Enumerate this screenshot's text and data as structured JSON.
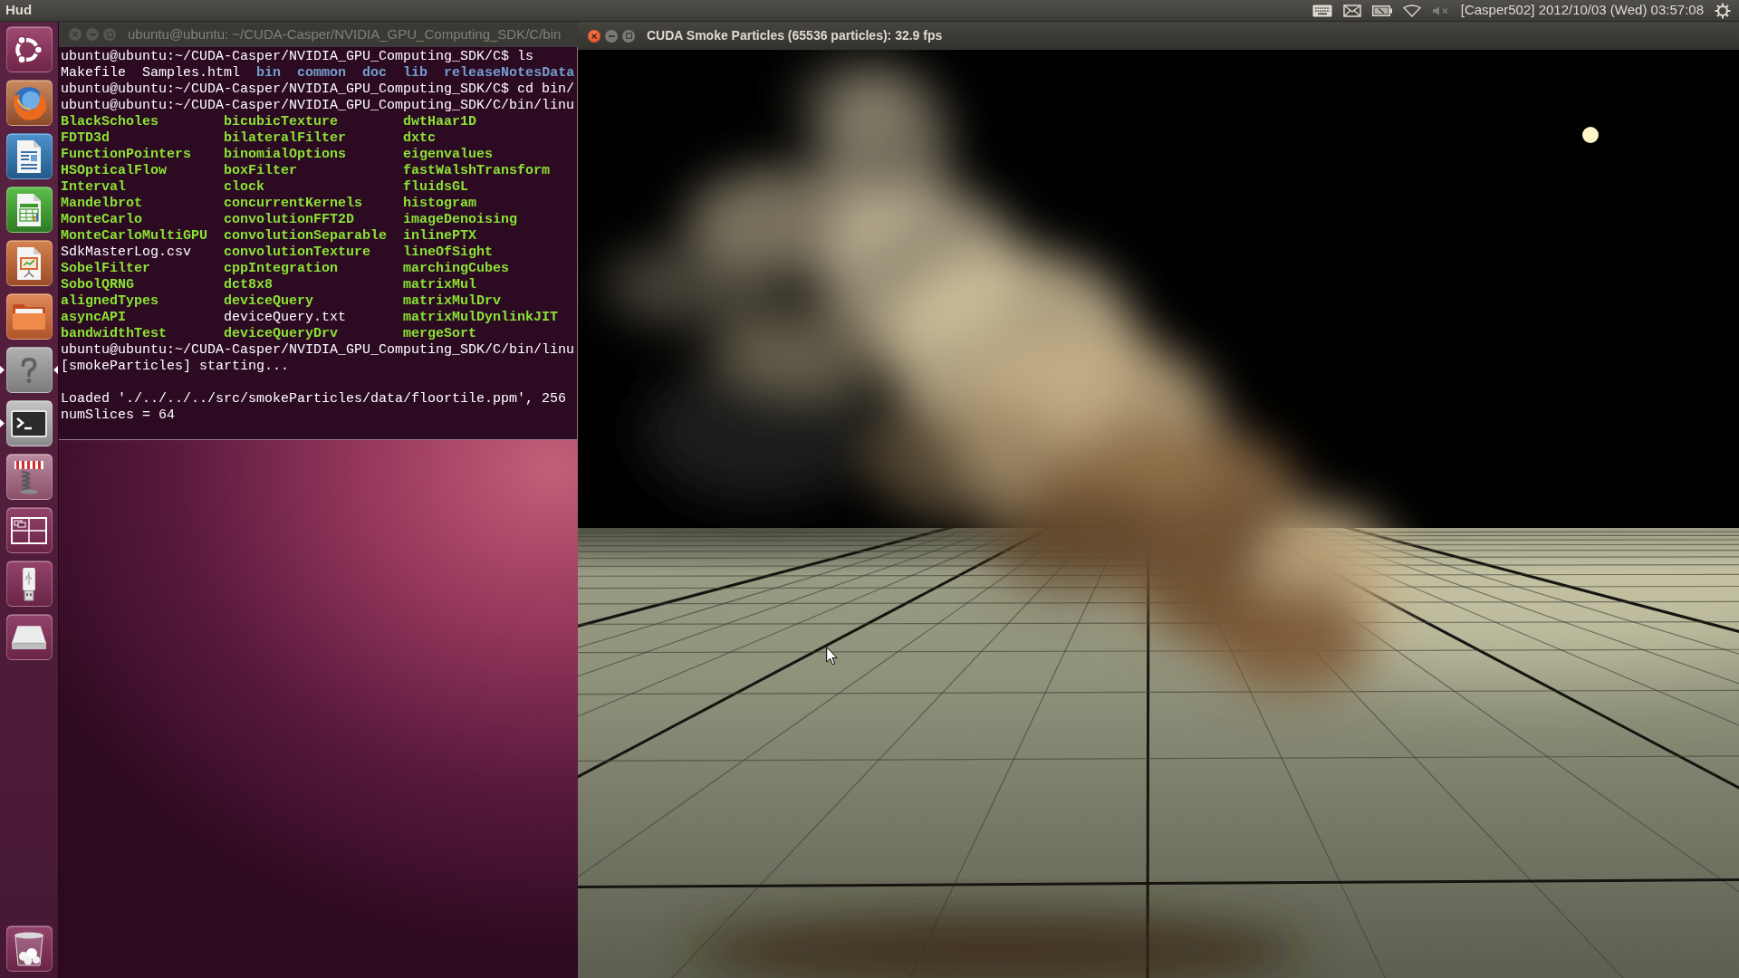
{
  "top_panel": {
    "title": "Hud",
    "sound_muted": true,
    "clock": "[Casper502] 2012/10/03 (Wed) 03:57:08"
  },
  "launcher": {
    "items": [
      {
        "kind": "dash",
        "running": false,
        "focused": false
      },
      {
        "kind": "browser",
        "running": false,
        "focused": false
      },
      {
        "kind": "writer",
        "running": false,
        "focused": false
      },
      {
        "kind": "calc",
        "running": false,
        "focused": false
      },
      {
        "kind": "impress",
        "running": false,
        "focused": false
      },
      {
        "kind": "files",
        "running": false,
        "focused": false
      },
      {
        "kind": "unknown",
        "running": true,
        "focused": true
      },
      {
        "kind": "terminal",
        "running": true,
        "focused": false
      },
      {
        "kind": "spring",
        "running": false,
        "focused": false
      },
      {
        "kind": "workspaces",
        "running": false,
        "focused": false
      },
      {
        "kind": "usb",
        "running": false,
        "focused": false
      },
      {
        "kind": "disk",
        "running": false,
        "focused": false
      },
      {
        "kind": "trash",
        "running": false,
        "focused": false
      }
    ]
  },
  "terminal_window": {
    "title": "ubuntu@ubuntu: ~/CUDA-Casper/NVIDIA_GPU_Computing_SDK/C/bin",
    "active": false,
    "lines": [
      {
        "kind": "text",
        "text": "ubuntu@ubuntu:~/CUDA-Casper/NVIDIA_GPU_Computing_SDK/C$ ls"
      },
      {
        "kind": "files",
        "items": [
          {
            "name": "Makefile",
            "kind": "file"
          },
          {
            "name": "Samples.html",
            "kind": "file"
          },
          {
            "name": "bin",
            "kind": "directory"
          },
          {
            "name": "common",
            "kind": "directory"
          },
          {
            "name": "doc",
            "kind": "directory"
          },
          {
            "name": "lib",
            "kind": "directory"
          },
          {
            "name": "releaseNotesData",
            "kind": "directory"
          }
        ]
      },
      {
        "kind": "text",
        "text": "ubuntu@ubuntu:~/CUDA-Casper/NVIDIA_GPU_Computing_SDK/C$ cd bin/"
      },
      {
        "kind": "text",
        "text": "ubuntu@ubuntu:~/CUDA-Casper/NVIDIA_GPU_Computing_SDK/C/bin/linu"
      },
      {
        "kind": "columns",
        "rows": [
          [
            {
              "name": "BlackScholes",
              "kind": "executable"
            },
            {
              "name": "bicubicTexture",
              "kind": "executable"
            },
            {
              "name": "dwtHaar1D",
              "kind": "executable"
            }
          ],
          [
            {
              "name": "FDTD3d",
              "kind": "executable"
            },
            {
              "name": "bilateralFilter",
              "kind": "executable"
            },
            {
              "name": "dxtc",
              "kind": "executable"
            }
          ],
          [
            {
              "name": "FunctionPointers",
              "kind": "executable"
            },
            {
              "name": "binomialOptions",
              "kind": "executable"
            },
            {
              "name": "eigenvalues",
              "kind": "executable"
            }
          ],
          [
            {
              "name": "HSOpticalFlow",
              "kind": "executable"
            },
            {
              "name": "boxFilter",
              "kind": "executable"
            },
            {
              "name": "fastWalshTransform",
              "kind": "executable"
            }
          ],
          [
            {
              "name": "Interval",
              "kind": "executable"
            },
            {
              "name": "clock",
              "kind": "executable"
            },
            {
              "name": "fluidsGL",
              "kind": "executable"
            }
          ],
          [
            {
              "name": "Mandelbrot",
              "kind": "executable"
            },
            {
              "name": "concurrentKernels",
              "kind": "executable"
            },
            {
              "name": "histogram",
              "kind": "executable"
            }
          ],
          [
            {
              "name": "MonteCarlo",
              "kind": "executable"
            },
            {
              "name": "convolutionFFT2D",
              "kind": "executable"
            },
            {
              "name": "imageDenoising",
              "kind": "executable"
            }
          ],
          [
            {
              "name": "MonteCarloMultiGPU",
              "kind": "executable"
            },
            {
              "name": "convolutionSeparable",
              "kind": "executable"
            },
            {
              "name": "inlinePTX",
              "kind": "executable"
            }
          ],
          [
            {
              "name": "SdkMasterLog.csv",
              "kind": "file"
            },
            {
              "name": "convolutionTexture",
              "kind": "executable"
            },
            {
              "name": "lineOfSight",
              "kind": "executable"
            }
          ],
          [
            {
              "name": "SobelFilter",
              "kind": "executable"
            },
            {
              "name": "cppIntegration",
              "kind": "executable"
            },
            {
              "name": "marchingCubes",
              "kind": "executable"
            }
          ],
          [
            {
              "name": "SobolQRNG",
              "kind": "executable"
            },
            {
              "name": "dct8x8",
              "kind": "executable"
            },
            {
              "name": "matrixMul",
              "kind": "executable"
            }
          ],
          [
            {
              "name": "alignedTypes",
              "kind": "executable"
            },
            {
              "name": "deviceQuery",
              "kind": "executable"
            },
            {
              "name": "matrixMulDrv",
              "kind": "executable"
            }
          ],
          [
            {
              "name": "asyncAPI",
              "kind": "executable"
            },
            {
              "name": "deviceQuery.txt",
              "kind": "file"
            },
            {
              "name": "matrixMulDynlinkJIT",
              "kind": "executable"
            }
          ],
          [
            {
              "name": "bandwidthTest",
              "kind": "executable"
            },
            {
              "name": "deviceQueryDrv",
              "kind": "executable"
            },
            {
              "name": "mergeSort",
              "kind": "executable"
            }
          ]
        ]
      },
      {
        "kind": "text",
        "text": "ubuntu@ubuntu:~/CUDA-Casper/NVIDIA_GPU_Computing_SDK/C/bin/linu"
      },
      {
        "kind": "text",
        "text": "[smokeParticles] starting..."
      },
      {
        "kind": "blank"
      },
      {
        "kind": "text",
        "text": "Loaded './../../../src/smokeParticles/data/floortile.ppm', 256"
      },
      {
        "kind": "text",
        "text": "numSlices = 64"
      }
    ]
  },
  "smoke_window": {
    "title": "CUDA Smoke Particles (65536 particles): 32.9 fps",
    "active": true
  }
}
